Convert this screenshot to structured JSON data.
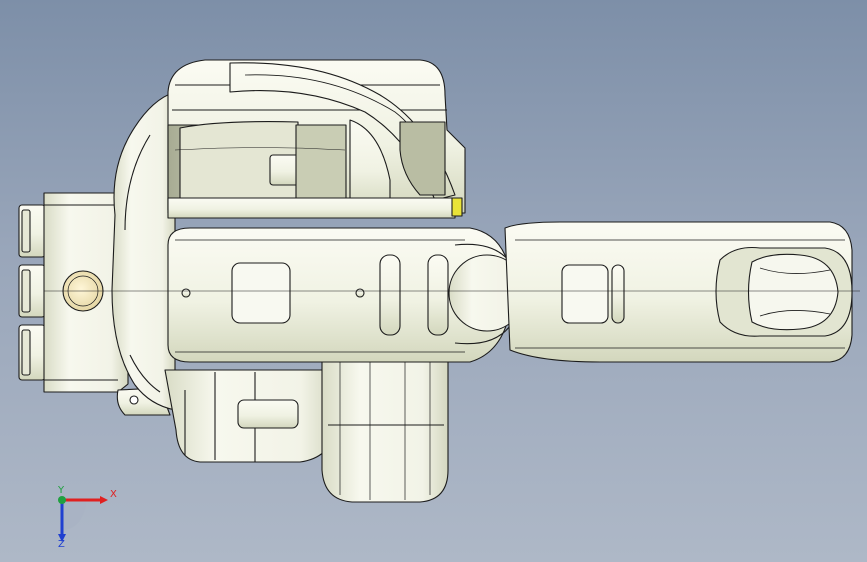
{
  "viewport": {
    "background_top": "#7d8fa8",
    "background_bottom": "#aeb8c7",
    "model_fill": "#f4f5ec",
    "model_shadow": "#d7dac6",
    "edge_color": "#1c1c1c",
    "accent_yellow": "#e9e338"
  },
  "triad": {
    "x_label": "X",
    "y_label": "Y",
    "z_label": "Z",
    "x_color": "#e02020",
    "y_color": "#20a040",
    "z_color": "#2040d0"
  },
  "model": {
    "name_icon": "robot-arm-model",
    "view": "top"
  }
}
